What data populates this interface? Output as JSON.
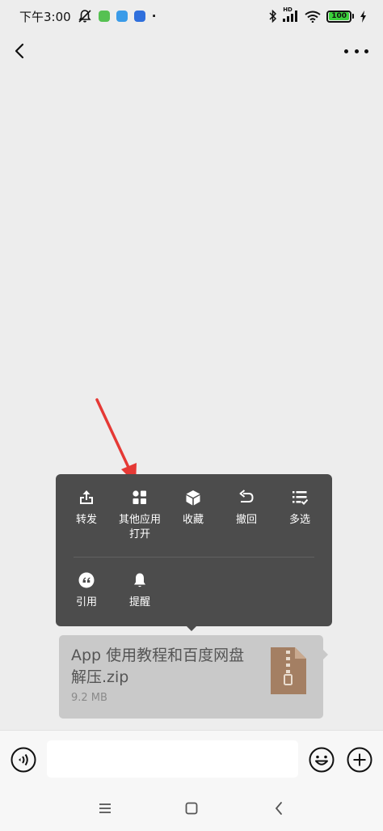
{
  "status_bar": {
    "time": "下午3:00",
    "extra_dot": "·",
    "hd_label": "HD",
    "battery_level": "100",
    "icons": [
      "mute-bell-icon",
      "app-notification-icon",
      "map-notification-icon",
      "baidu-notification-icon",
      "bluetooth-icon",
      "signal-icon",
      "wifi-icon",
      "battery-icon",
      "charging-icon"
    ]
  },
  "nav": {
    "icons": [
      "back-chevron-icon",
      "more-dots-icon"
    ]
  },
  "context_menu": {
    "row1": [
      {
        "label": "转发",
        "icon": "share-upload-icon"
      },
      {
        "label": "其他应用\n打开",
        "label_line1": "其他应用",
        "label_line2": "打开",
        "icon": "grid-apps-icon"
      },
      {
        "label": "收藏",
        "icon": "cube-favorite-icon"
      },
      {
        "label": "撤回",
        "icon": "undo-icon"
      },
      {
        "label": "多选",
        "icon": "multi-select-icon"
      }
    ],
    "row2": [
      {
        "label": "引用",
        "icon": "quote-icon"
      },
      {
        "label": "提醒",
        "icon": "bell-icon"
      }
    ]
  },
  "file_message": {
    "name": "App 使用教程和百度网盘解压.zip",
    "size": "9.2 MB",
    "icon": "zip-file-icon"
  },
  "input_bar": {
    "value": "",
    "icons": [
      "voice-icon",
      "emoji-icon",
      "plus-icon"
    ]
  },
  "system_nav": {
    "icons": [
      "menu-lines-icon",
      "home-square-icon",
      "back-triangle-icon"
    ]
  },
  "colors": {
    "background": "#ededed",
    "menu_bg": "#4c4c4c",
    "bubble_bg": "#c9c9c9",
    "annotation_arrow": "#e53935",
    "battery_fill": "#3bd13b"
  }
}
